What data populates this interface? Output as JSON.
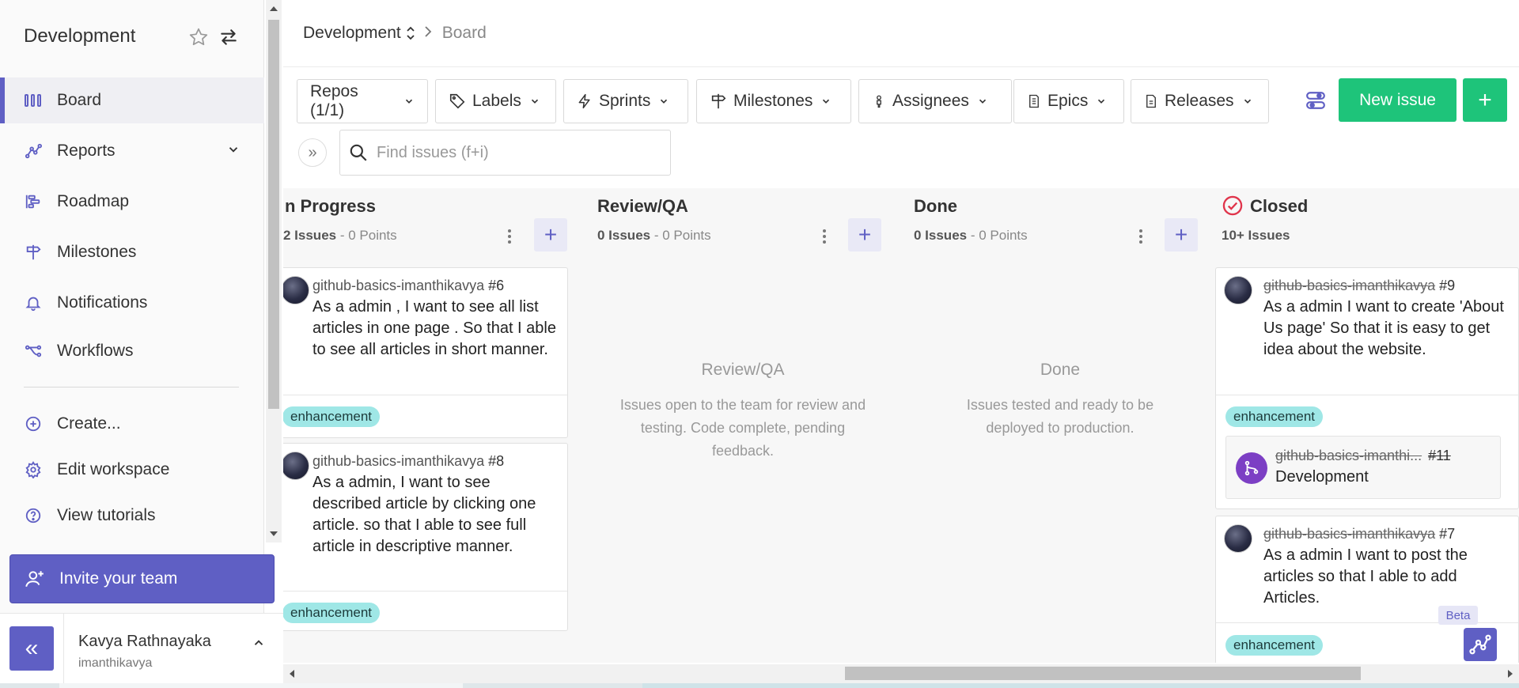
{
  "sidebar": {
    "workspace_title": "Development",
    "items": [
      {
        "label": "Board",
        "icon": "board-icon",
        "active": true
      },
      {
        "label": "Reports",
        "icon": "reports-icon"
      },
      {
        "label": "Roadmap",
        "icon": "roadmap-icon"
      },
      {
        "label": "Milestones",
        "icon": "milestones-icon"
      },
      {
        "label": "Notifications",
        "icon": "bell-icon"
      },
      {
        "label": "Workflows",
        "icon": "workflows-icon"
      }
    ],
    "actions": [
      {
        "label": "Create...",
        "icon": "plus-circle-icon"
      },
      {
        "label": "Edit workspace",
        "icon": "gear-icon"
      },
      {
        "label": "View tutorials",
        "icon": "help-icon"
      }
    ],
    "invite_label": "Invite your team",
    "collapse_glyph": "«",
    "user": {
      "name": "Kavya Rathnayaka",
      "handle": "imanthikavya"
    }
  },
  "breadcrumb": {
    "workspace": "Development",
    "page": "Board"
  },
  "filters": {
    "repos": "Repos (1/1)",
    "labels": "Labels",
    "sprints": "Sprints",
    "milestones": "Milestones",
    "assignees": "Assignees",
    "epics": "Epics",
    "releases": "Releases"
  },
  "actions": {
    "new_issue": "New issue",
    "plus": "+",
    "expand": "»"
  },
  "search": {
    "placeholder": "Find issues (f+i)"
  },
  "columns": {
    "in_progress": {
      "title": "n Progress",
      "count": "2 Issues",
      "points": " - 0 Points",
      "cards": [
        {
          "repo": "github-basics-imanthikavya",
          "num": "#6",
          "title": "As a admin , I want to see all list articles in one page . So that I able to see all articles in short manner.",
          "label": "enhancement"
        },
        {
          "repo": "github-basics-imanthikavya",
          "num": "#8",
          "title": "As a admin, I want to see described article by clicking one article. so that I able to see full article in descriptive manner.",
          "label": "enhancement"
        }
      ]
    },
    "review": {
      "title": "Review/QA",
      "count": "0 Issues",
      "points": " - 0 Points",
      "empty_title": "Review/QA",
      "empty_desc": "Issues open to the team for review and testing. Code complete, pending feedback."
    },
    "done": {
      "title": "Done",
      "count": "0 Issues",
      "points": " - 0 Points",
      "empty_title": "Done",
      "empty_desc": "Issues tested and ready to be deployed to production."
    },
    "closed": {
      "title": "Closed",
      "count": "10+ Issues",
      "cards": [
        {
          "repo": "github-basics-imanthikavya",
          "num": "#9",
          "title": "As a admin I want to create 'About Us page' So that it is easy to get idea about the website.",
          "label": "enhancement",
          "linked": {
            "repo": "github-basics-imanthi...",
            "num": "#11",
            "title": "Development"
          }
        },
        {
          "repo": "github-basics-imanthikavya",
          "num": "#7",
          "title": "As a admin I want to post the articles so that I able to add Articles.",
          "label": "enhancement"
        }
      ]
    }
  },
  "beta_label": "Beta",
  "colors": {
    "accent": "#5f5fc4",
    "primary_green": "#1ec47a",
    "label_bg": "#9fe7e6",
    "closed_red": "#e0344b",
    "pr_purple": "#7c3fc4"
  }
}
